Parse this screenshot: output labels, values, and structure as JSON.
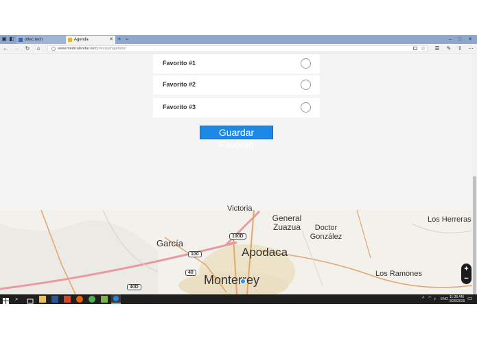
{
  "browser": {
    "tabs": [
      {
        "title": "ottec.tech",
        "active": false
      },
      {
        "title": "Agenda",
        "active": true
      }
    ],
    "new_tab_glyph": "+",
    "tab_menu_glyph": "⌄",
    "window_controls": [
      "–",
      "□",
      "✕"
    ],
    "url_domain": "www.medicalendar.net",
    "url_path": "/principal/agendar/",
    "nav_glyphs": {
      "back": "←",
      "forward": "→",
      "refresh": "↻",
      "home": "⌂"
    }
  },
  "favorites": {
    "items": [
      {
        "label": "Favorito #1",
        "selected": false
      },
      {
        "label": "Favorito #2",
        "selected": false
      },
      {
        "label": "Favorito #3",
        "selected": false
      }
    ],
    "save_button_label": "Guardar Favorito"
  },
  "map": {
    "cities": [
      {
        "name": "Victoria"
      },
      {
        "name": "General Zuazua"
      },
      {
        "name": "Doctor González"
      },
      {
        "name": "Los Herreras"
      },
      {
        "name": "García"
      },
      {
        "name": "Apodaca"
      },
      {
        "name": "Monterrey"
      },
      {
        "name": "Los Ramones"
      }
    ],
    "highway_shields": [
      "100D",
      "100",
      "40",
      "40D"
    ],
    "zoom_in_label": "+",
    "zoom_out_label": "−"
  },
  "taskbar": {
    "clock_time": "11:36 AM",
    "clock_date": "8/26/2016",
    "language": "ENG"
  },
  "colors": {
    "tab_bar": "#8ea8cd",
    "button_blue": "#1e88e5",
    "taskbar": "#1f1f1f"
  }
}
